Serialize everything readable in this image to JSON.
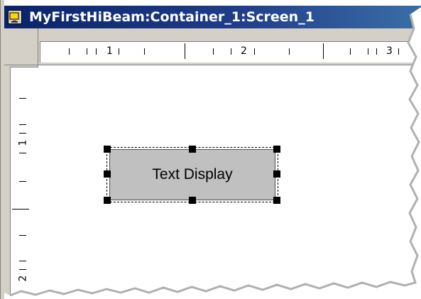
{
  "window": {
    "title": "MyFirstHiBeam:Container_1:Screen_1",
    "app_icon": "app-icon",
    "titlebar_color": "#0a246a"
  },
  "horizontal_ruler": {
    "labels": [
      "1",
      "2",
      "3"
    ]
  },
  "vertical_ruler": {
    "labels": [
      "1",
      "2"
    ]
  },
  "canvas": {
    "background": "#ffffff",
    "widget": {
      "label": "Text Display",
      "fill": "#c0c0c0",
      "selected": true
    }
  }
}
